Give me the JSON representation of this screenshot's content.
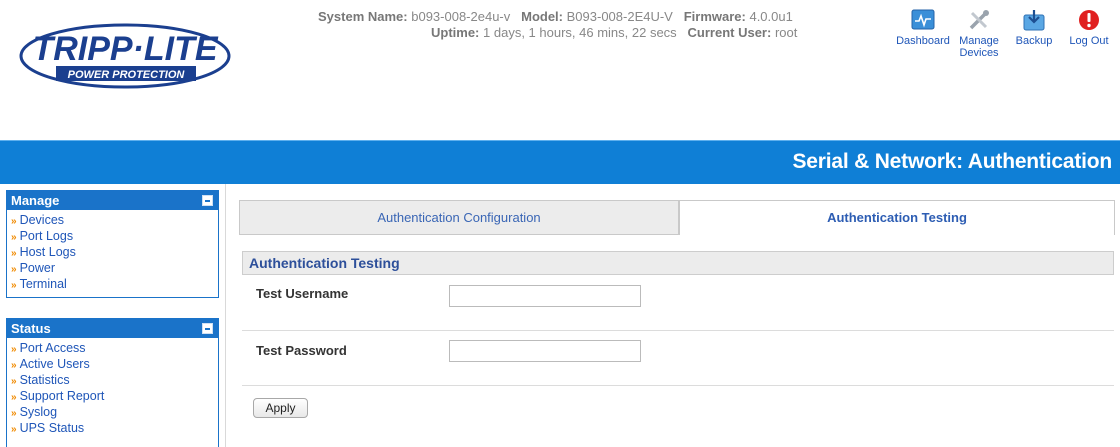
{
  "brand": {
    "logo_text": "TRIPP·LITE",
    "logo_subtext": "POWER PROTECTION"
  },
  "system_info": {
    "system_name_label": "System Name:",
    "system_name": "b093-008-2e4u-v",
    "model_label": "Model:",
    "model": "B093-008-2E4U-V",
    "firmware_label": "Firmware:",
    "firmware": "4.0.0u1",
    "uptime_label": "Uptime:",
    "uptime": "1 days, 1 hours, 46 mins, 22 secs",
    "current_user_label": "Current User:",
    "current_user": "root"
  },
  "top_nav": [
    {
      "label": "Dashboard",
      "icon": "dashboard-icon"
    },
    {
      "label": "Manage Devices",
      "icon": "tools-icon"
    },
    {
      "label": "Backup",
      "icon": "backup-icon"
    },
    {
      "label": "Log Out",
      "icon": "logout-icon"
    }
  ],
  "page_title": "Serial & Network: Authentication",
  "sidebar": {
    "manage": {
      "title": "Manage",
      "items": [
        "Devices",
        "Port Logs",
        "Host Logs",
        "Power",
        "Terminal"
      ]
    },
    "status": {
      "title": "Status",
      "items": [
        "Port Access",
        "Active Users",
        "Statistics",
        "Support Report",
        "Syslog",
        "UPS Status"
      ]
    }
  },
  "tabs": [
    {
      "label": "Authentication Configuration",
      "active": false
    },
    {
      "label": "Authentication Testing",
      "active": true
    }
  ],
  "section": {
    "title": "Authentication Testing",
    "username_label": "Test Username",
    "username_value": "",
    "password_label": "Test Password",
    "password_value": "",
    "apply_label": "Apply"
  },
  "colors": {
    "title_bar": "#0f7fd6",
    "sidebar_header": "#1a73c9",
    "link": "#1f56b8",
    "arrow": "#f08a00"
  }
}
